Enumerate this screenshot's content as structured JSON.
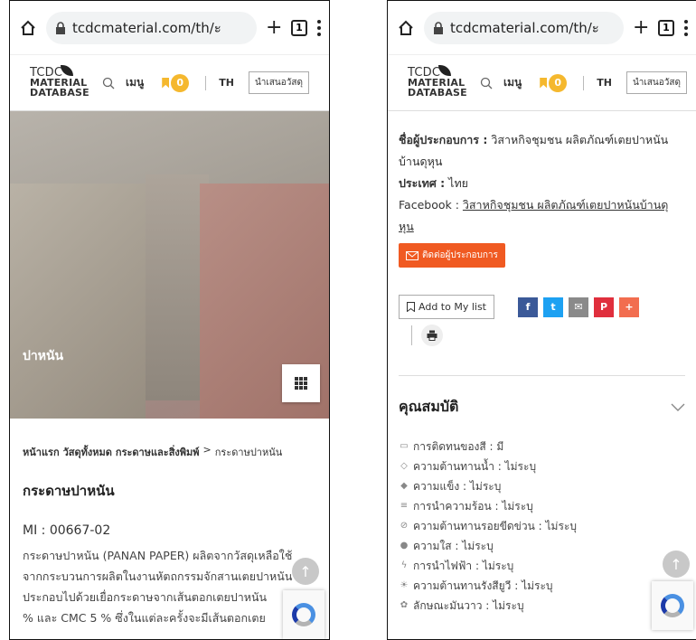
{
  "left": {
    "browser": {
      "url": "tcdcmaterial.com/th/ะ",
      "tabs": "1"
    },
    "header": {
      "logo_l1": "TCDC",
      "logo_l2": "MATERIAL",
      "logo_l3": "DATABASE",
      "menu": "เมนู",
      "bookmark_count": "0",
      "lang": "TH",
      "suggest": "นำเสนอวัสดุ"
    },
    "hero": {
      "brand": "ปาหนัน"
    },
    "breadcrumb": {
      "home": "หน้าแรก",
      "all": "วัสดุทั้งหมด",
      "category": "กระดาษและสิ่งพิมพ์",
      "sep": ">",
      "current": "กระดาษปาหนัน"
    },
    "title": "กระดาษปาหนัน",
    "mi": "MI : 00667-02",
    "desc": [
      "กระดาษปาหนัน (PANAN PAPER) ผลิตจากวัสดุเหลือใช้",
      "จากกระบวนการผลิตในงานหัตถกรรมจักสานเตยปาหนัน",
      "ประกอบไปด้วยเยื่อกระดาษจากเส้นตอกเตยปาหนัน",
      "% และ CMC 5 % ซึ่งในแต่ละครั้งจะมีเส้นตอกเตย"
    ]
  },
  "right": {
    "browser": {
      "url": "tcdcmaterial.com/th/ะ",
      "tabs": "1"
    },
    "header": {
      "logo_l1": "TCDC",
      "logo_l2": "MATERIAL",
      "logo_l3": "DATABASE",
      "menu": "เมนู",
      "bookmark_count": "0",
      "lang": "TH",
      "suggest": "นำเสนอวัสดุ"
    },
    "producer_label": "ชื่อผู้ประกอบการ :",
    "producer_value": "วิสาหกิจชุมชน ผลิตภัณฑ์เตยปาหนัน",
    "producer_value2": "บ้านดุหุน",
    "country_label": "ประเทศ :",
    "country_value": "ไทย",
    "facebook_label": "Facebook :",
    "facebook_link1": "วิสาหกิจชุมชน ผลิตภัณฑ์เตยปาหนันบ้านดุ",
    "facebook_link2": "หุน",
    "contact_button": "ติดต่อผู้ประกอบการ",
    "add_to_list": "Add to My list",
    "social": [
      {
        "label": "f",
        "color": "#3b5998",
        "icon": "facebook-icon"
      },
      {
        "label": "t",
        "color": "#1da1f2",
        "icon": "twitter-icon"
      },
      {
        "label": "✉",
        "color": "#8a8a8a",
        "icon": "email-icon"
      },
      {
        "label": "P",
        "color": "#e02f3d",
        "icon": "pinterest-icon"
      },
      {
        "label": "+",
        "color": "#f26d4f",
        "icon": "plus-icon"
      }
    ],
    "properties_title": "คุณสมบัติ",
    "properties": [
      {
        "icon": "▭",
        "text": "การติดทนของสี : มี"
      },
      {
        "icon": "◇",
        "text": "ความต้านทานน้ำ : ไม่ระบุ"
      },
      {
        "icon": "◆",
        "text": "ความแข็ง : ไม่ระบุ"
      },
      {
        "icon": "≡",
        "text": "การนำความร้อน : ไม่ระบุ"
      },
      {
        "icon": "⊘",
        "text": "ความต้านทานรอยขีดข่วน : ไม่ระบุ"
      },
      {
        "icon": "●",
        "text": "ความใส : ไม่ระบุ"
      },
      {
        "icon": "ϟ",
        "text": "การนำไฟฟ้า : ไม่ระบุ"
      },
      {
        "icon": "☀",
        "text": "ความต้านทานรังสียูวี : ไม่ระบุ"
      },
      {
        "icon": "✿",
        "text": "ลักษณะมันวาว : ไม่ระบุ"
      }
    ]
  }
}
